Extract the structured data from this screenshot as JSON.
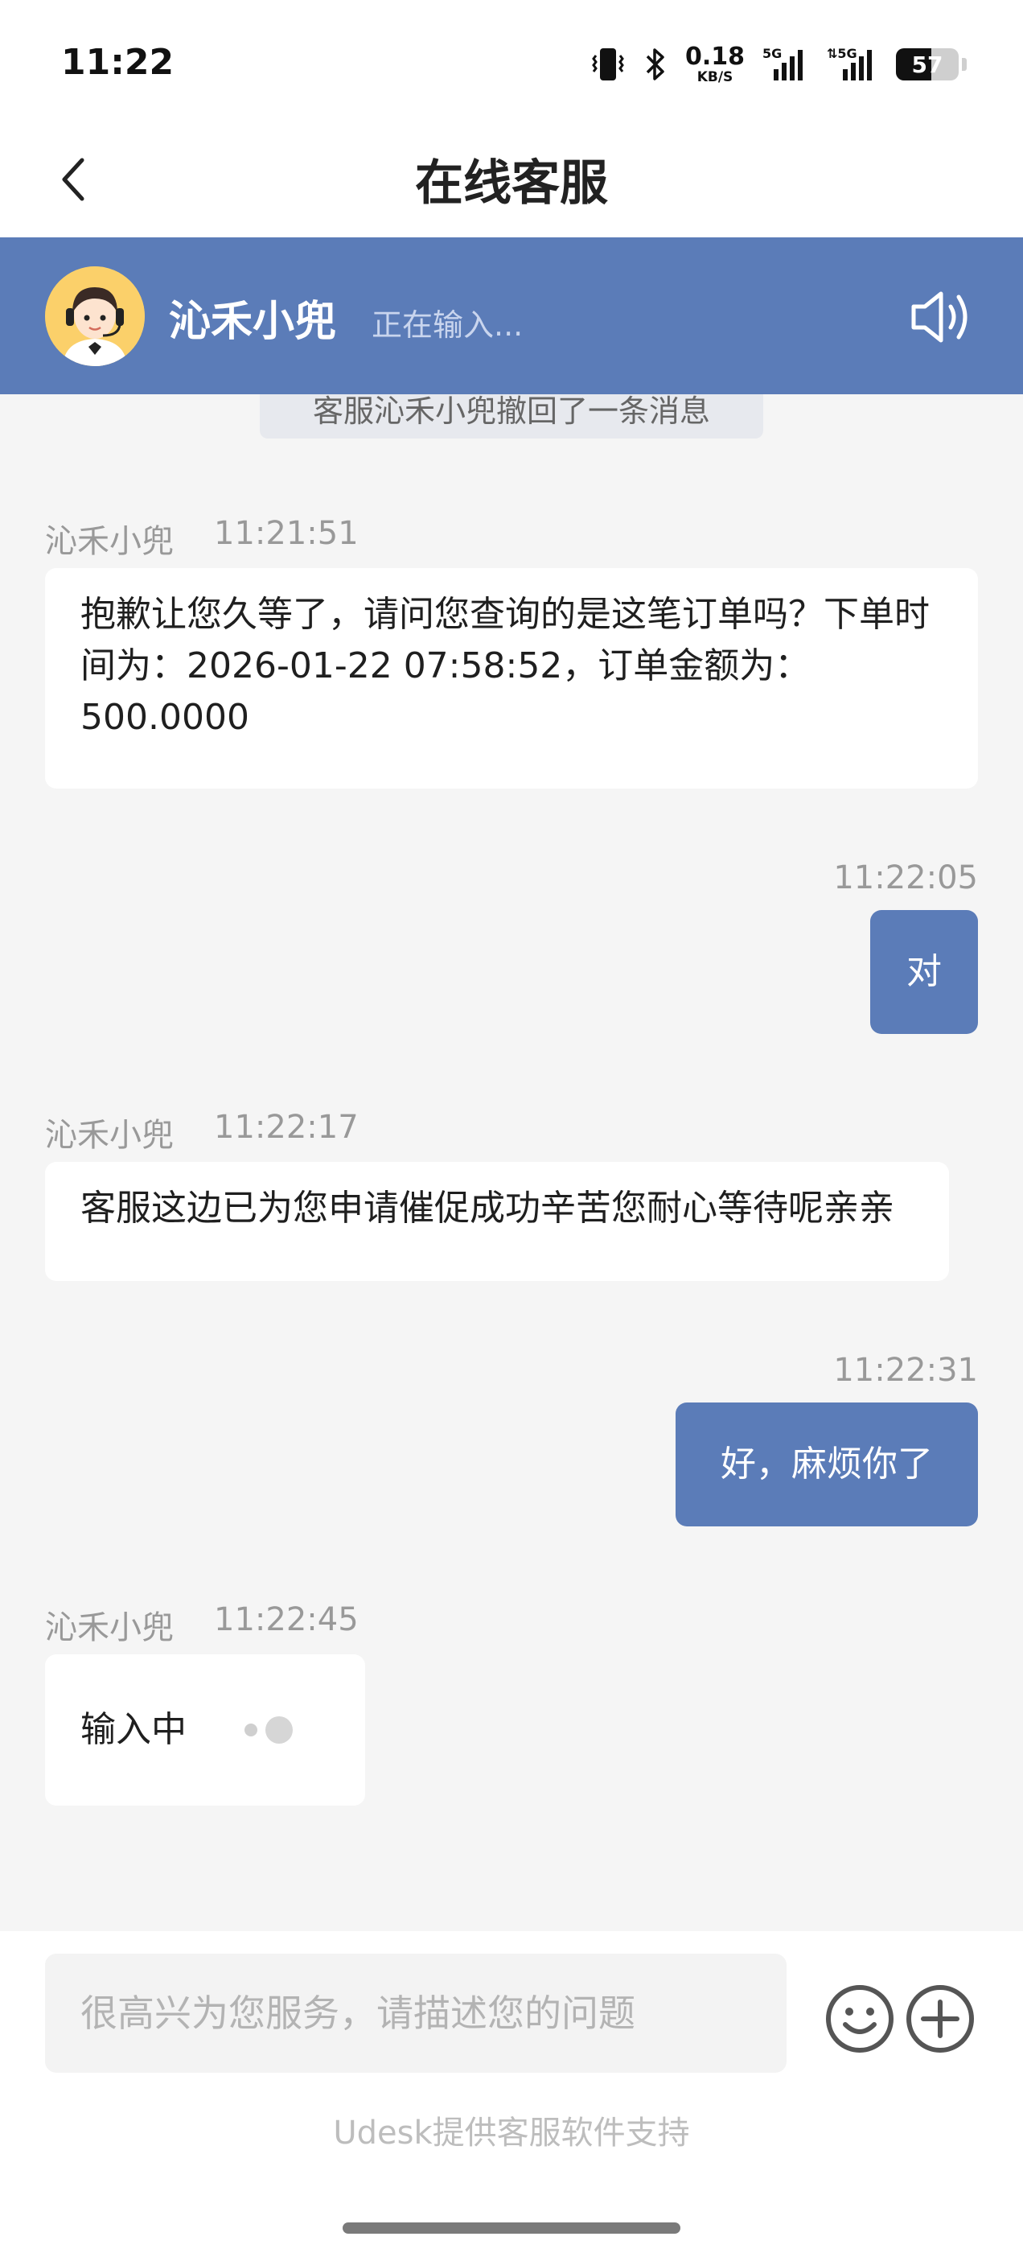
{
  "status_bar": {
    "time": "11:22",
    "net_speed_value": "0.18",
    "net_speed_unit": "KB/S",
    "sim1_label": "5G",
    "sim2_label": "5G",
    "battery_level": "57",
    "icons": [
      "vibrate-icon",
      "bluetooth-icon",
      "signal-icon",
      "signal-icon",
      "battery-icon"
    ]
  },
  "nav": {
    "title": "在线客服",
    "back_icon": "chevron-left-icon"
  },
  "agent": {
    "name": "沁禾小兜",
    "status": "正在输入...",
    "speaker_icon": "speaker-icon"
  },
  "chat": {
    "system_notice": "客服沁禾小兜撤回了一条消息",
    "messages": [
      {
        "side": "agent",
        "sender": "沁禾小兜",
        "time": "11:21:51",
        "text": "抱歉让您久等了，请问您查询的是这笔订单吗？下单时间为：2026-01-22 07:58:52，订单金额为：500.0000"
      },
      {
        "side": "user",
        "time": "11:22:05",
        "text": "对"
      },
      {
        "side": "agent",
        "sender": "沁禾小兜",
        "time": "11:22:17",
        "text": "客服这边已为您申请催促成功辛苦您耐心等待呢亲亲"
      },
      {
        "side": "user",
        "time": "11:22:31",
        "text": "好，麻烦你了"
      },
      {
        "side": "agent",
        "sender": "沁禾小兜",
        "time": "11:22:45",
        "text": "输入中"
      }
    ]
  },
  "input": {
    "placeholder": "很高兴为您服务，请描述您的问题",
    "value": ""
  },
  "footer": {
    "powered_by": "Udesk提供客服软件支持"
  },
  "colors": {
    "accent": "#5b7cb8",
    "background": "#f5f5f5",
    "bubble_agent": "#ffffff",
    "bubble_user": "#5b7cb8"
  }
}
